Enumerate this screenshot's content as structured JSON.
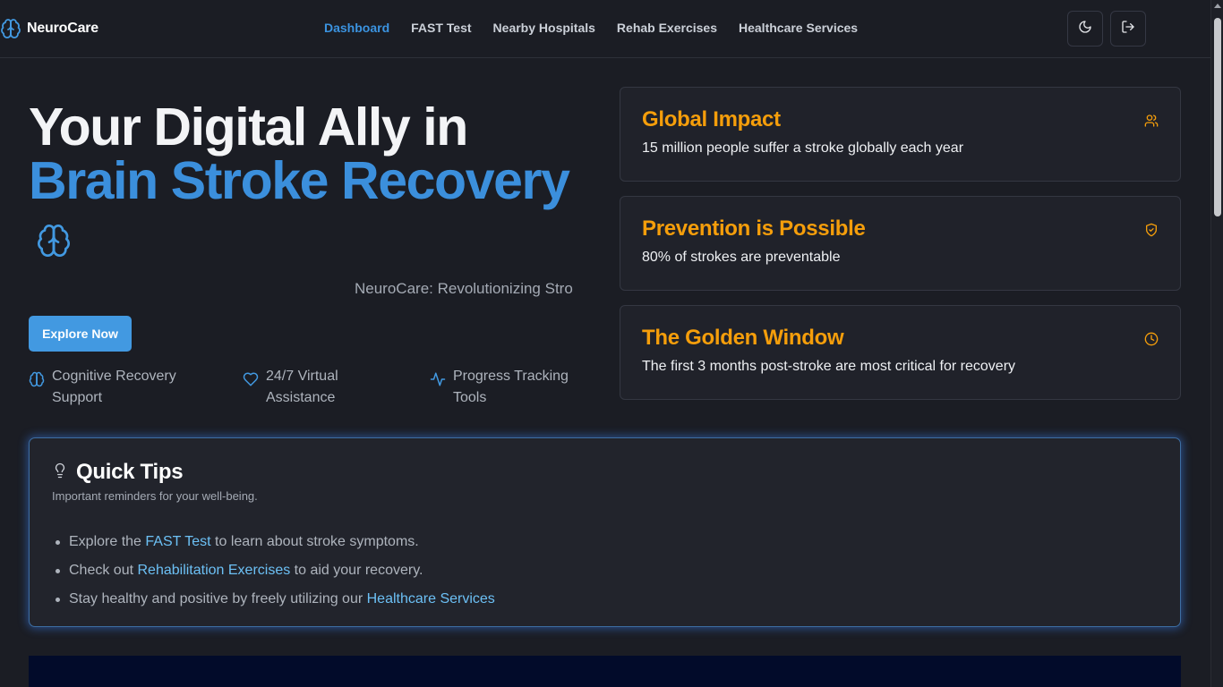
{
  "app": {
    "name": "NeuroCare"
  },
  "nav": {
    "links": [
      {
        "label": "Dashboard",
        "active": true
      },
      {
        "label": "FAST Test",
        "active": false
      },
      {
        "label": "Nearby Hospitals",
        "active": false
      },
      {
        "label": "Rehab Exercises",
        "active": false
      },
      {
        "label": "Healthcare Services",
        "active": false
      }
    ],
    "buttons": [
      {
        "icon": "moon-icon"
      },
      {
        "icon": "logout-icon"
      }
    ]
  },
  "hero": {
    "title_line1": "Your Digital Ally in",
    "title_line2": "Brain Stroke Recovery",
    "subtitle": "NeuroCare: Revolutionizing Stro",
    "cta_label": "Explore Now",
    "features": [
      {
        "icon": "brain-icon",
        "label": "Cognitive Recovery Support"
      },
      {
        "icon": "heart-icon",
        "label": "24/7 Virtual Assistance"
      },
      {
        "icon": "activity-icon",
        "label": "Progress Tracking Tools"
      }
    ]
  },
  "stats": [
    {
      "title": "Global Impact",
      "description": "15 million people suffer a stroke globally each year",
      "icon": "users-icon"
    },
    {
      "title": "Prevention is Possible",
      "description": "80% of strokes are preventable",
      "icon": "shield-check-icon"
    },
    {
      "title": "The Golden Window",
      "description": "The first 3 months post-stroke are most critical for recovery",
      "icon": "clock-icon"
    }
  ],
  "tips": {
    "title": "Quick Tips",
    "subtitle": "Important reminders for your well-being.",
    "items": [
      {
        "before": "Explore the ",
        "link": "FAST Test",
        "after": " to learn about stroke symptoms."
      },
      {
        "before": "Check out ",
        "link": "Rehabilitation Exercises",
        "after": " to aid your recovery."
      },
      {
        "before": "Stay healthy and positive by freely utilizing our ",
        "link": "Healthcare Services",
        "after": ""
      }
    ]
  },
  "colors": {
    "background": "#1b1d24",
    "accent_blue": "#3b8fdc",
    "accent_orange": "#f59e0b",
    "link": "#6cc0f5",
    "button": "#4299e1"
  }
}
